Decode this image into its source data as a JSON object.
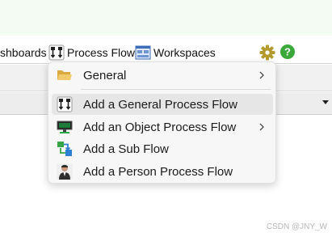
{
  "toolbar": {
    "dashboards_label": "shboards",
    "process_flow_label": "Process Flow",
    "workspaces_label": "Workspaces",
    "process_flow_icon": "process-flow-icon",
    "workspaces_icon": "workspaces-icon",
    "settings_icon": "gear-icon",
    "help_icon": "help-icon"
  },
  "menu": {
    "items": [
      {
        "label": "General",
        "icon": "folder-open-icon",
        "has_submenu": true
      },
      {
        "label": "Add a General Process Flow",
        "icon": "process-flow-icon",
        "has_submenu": false,
        "highlighted": true
      },
      {
        "label": "Add an Object Process Flow",
        "icon": "object-monitor-icon",
        "has_submenu": true
      },
      {
        "label": "Add a Sub Flow",
        "icon": "sub-flow-icon",
        "has_submenu": false
      },
      {
        "label": "Add a Person Process Flow",
        "icon": "person-icon",
        "has_submenu": false
      }
    ]
  },
  "watermark": "CSDN @JNY_W",
  "colors": {
    "banner": "#f3fbf2",
    "menu_background": "#f7f7f7",
    "menu_highlight": "#e6e6e6",
    "gear": "#b49a2c",
    "help": "#3aa83a"
  }
}
